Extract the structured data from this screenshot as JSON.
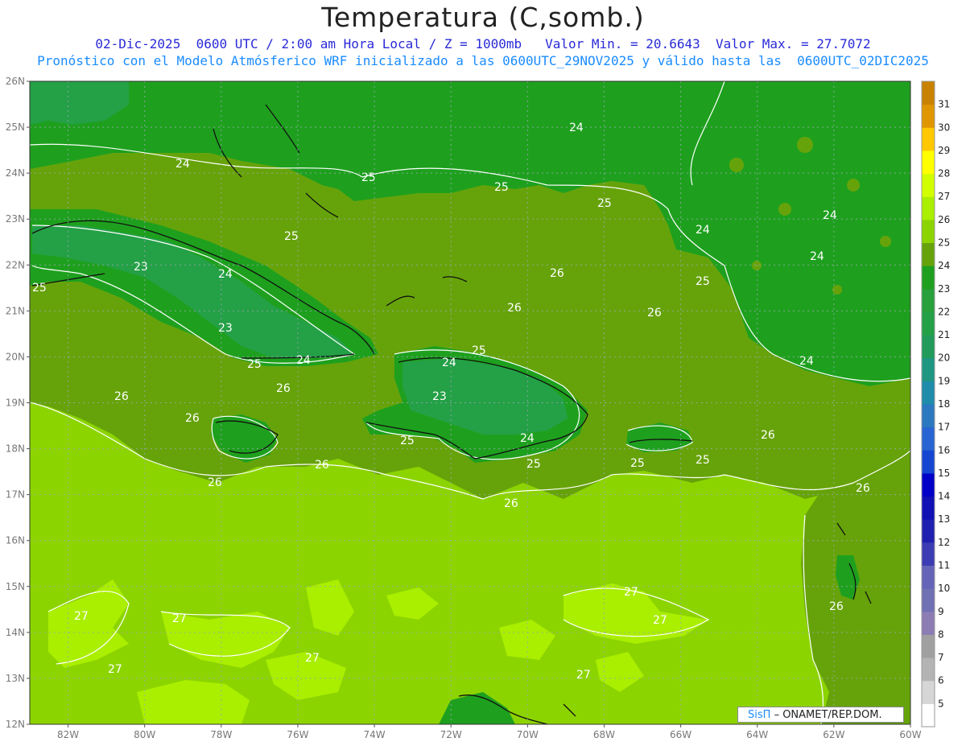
{
  "header": {
    "title": "Temperatura (C,somb.)",
    "line1": "02-Dic-2025  0600 UTC / 2:00 am Hora Local / Z = 1000mb   Valor Min. = 20.6643  Valor Max. = 27.7072",
    "line2": "Pronóstico con el Modelo Atmósferico WRF inicializado a las 0600UTC_29NOV2025 y válido hasta las  0600UTC_02DIC2025"
  },
  "axes": {
    "lat_labels": [
      "26N",
      "25N",
      "24N",
      "23N",
      "22N",
      "21N",
      "20N",
      "19N",
      "18N",
      "17N",
      "16N",
      "15N",
      "14N",
      "13N",
      "12N"
    ],
    "lon_labels": [
      "82W",
      "80W",
      "78W",
      "76W",
      "74W",
      "72W",
      "70W",
      "68W",
      "66W",
      "64W",
      "62W",
      "60W"
    ]
  },
  "colorbar": {
    "values": [
      "5",
      "6",
      "7",
      "8",
      "9",
      "10",
      "11",
      "12",
      "13",
      "14",
      "15",
      "16",
      "17",
      "18",
      "19",
      "20",
      "21",
      "22",
      "23",
      "24",
      "25",
      "26",
      "27",
      "28",
      "29",
      "30",
      "31"
    ],
    "colors": [
      "#ffffff",
      "#d6d6d6",
      "#b4b4b4",
      "#a0a0a0",
      "#8c7cb4",
      "#7070b4",
      "#6464b8",
      "#3c3cb4",
      "#2020b0",
      "#1010b4",
      "#0000c8",
      "#1446d2",
      "#2864d2",
      "#2c78c0",
      "#1e8caa",
      "#1e9682",
      "#229a5a",
      "#24a046",
      "#28a03c",
      "#1ea01e",
      "#66a30a",
      "#8cd400",
      "#aaee00",
      "#d2ff00",
      "#ffff00",
      "#ffc800",
      "#e09600",
      "#c88200"
    ]
  },
  "contour_labels": [
    "24",
    "24",
    "25",
    "25",
    "25",
    "25",
    "24",
    "24",
    "24",
    "25",
    "23",
    "24",
    "26",
    "26",
    "25",
    "26",
    "23",
    "24",
    "25",
    "25",
    "24",
    "26",
    "26",
    "26",
    "24",
    "23",
    "25",
    "25",
    "24",
    "25",
    "25",
    "26",
    "26",
    "26",
    "26",
    "26",
    "27",
    "27",
    "27",
    "27",
    "27",
    "27",
    "27"
  ],
  "credit": {
    "brand": "SisΠ",
    "text": "– ONAMET/REP.DOM."
  }
}
